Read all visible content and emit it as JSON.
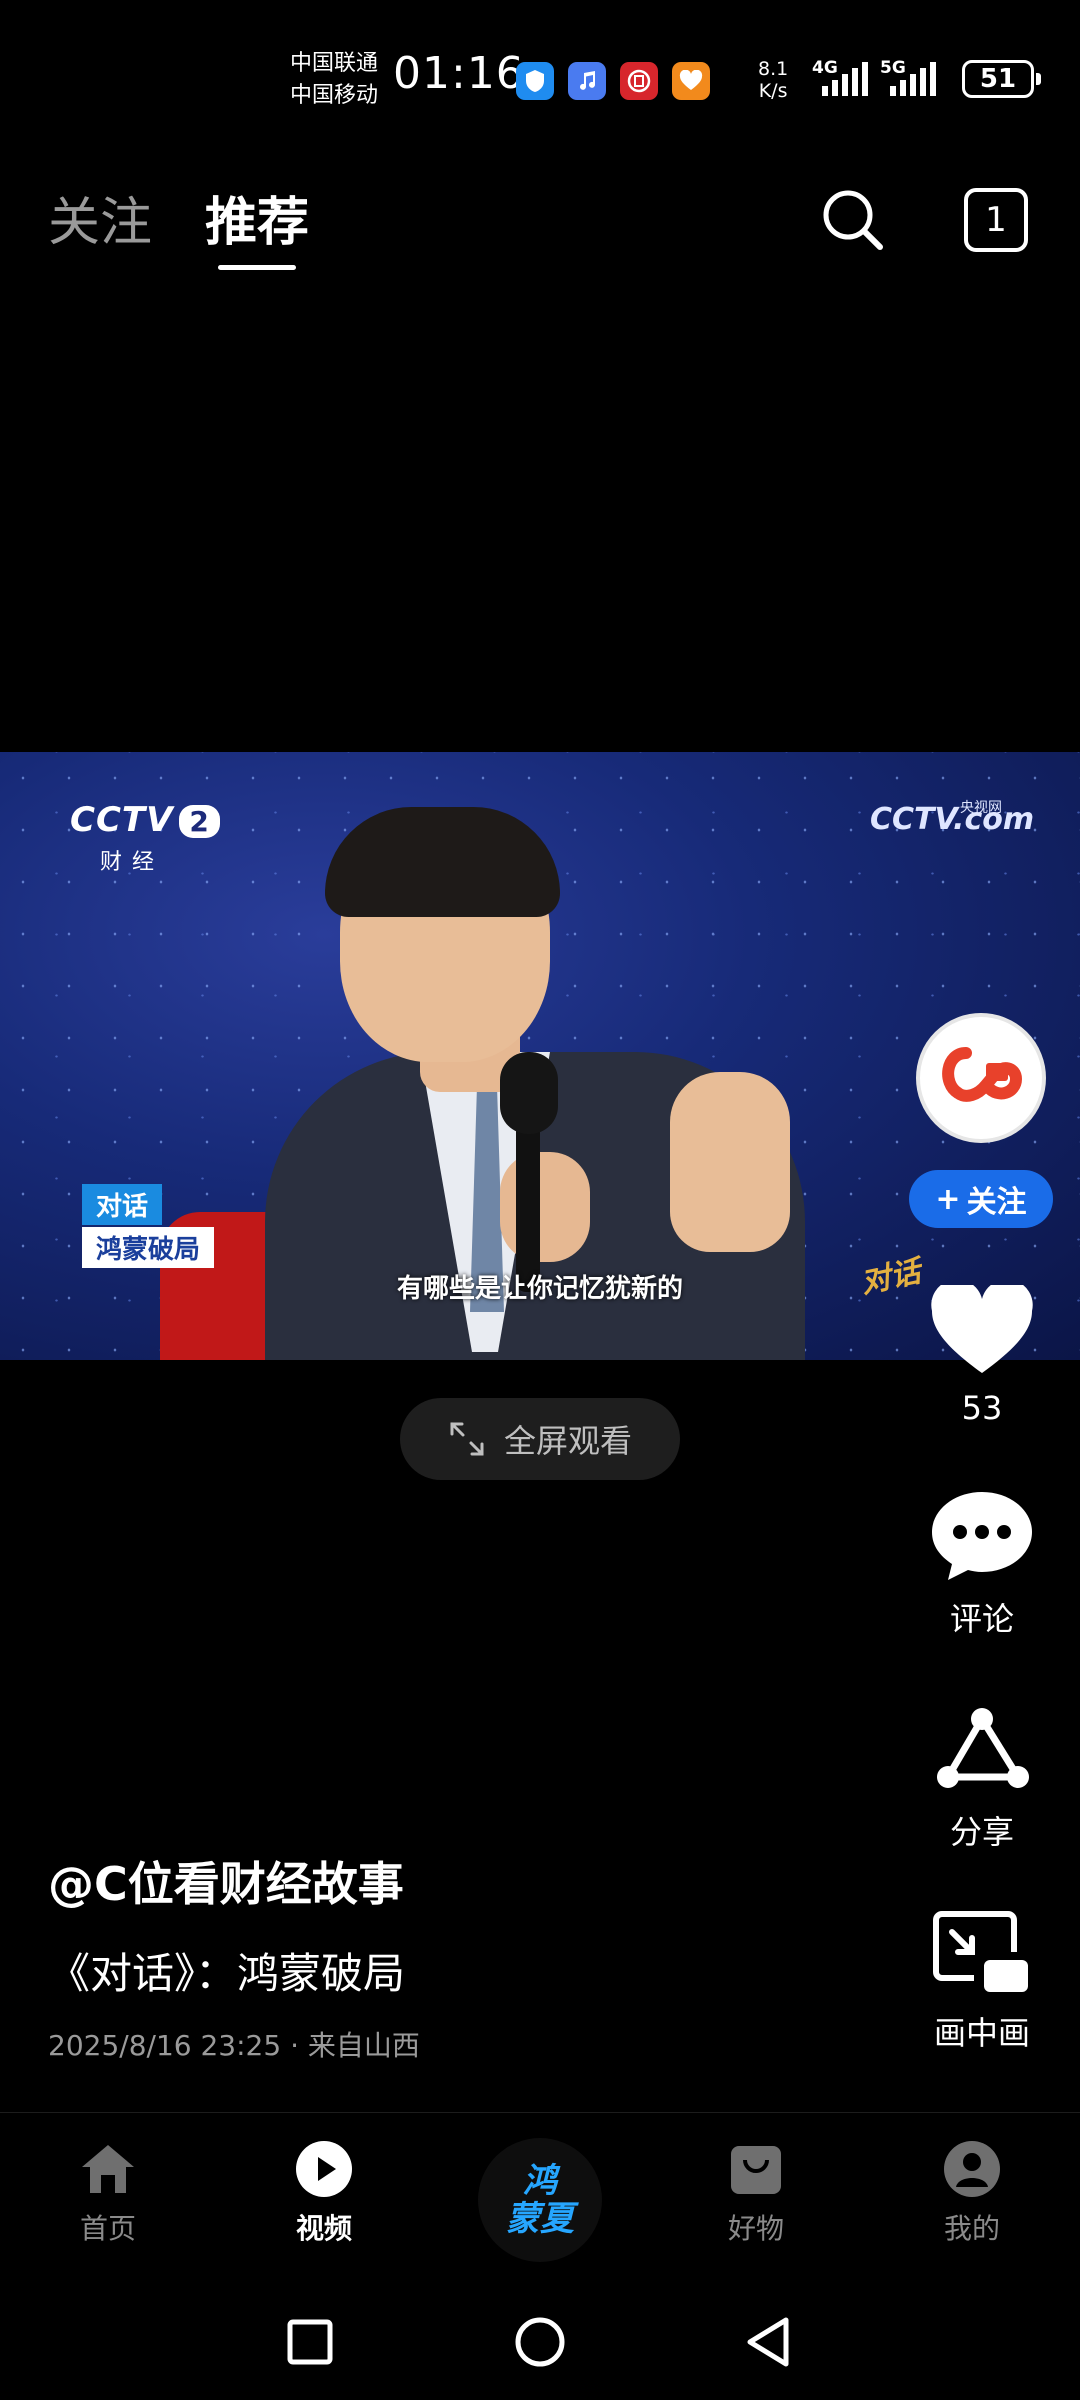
{
  "status_bar": {
    "carrier_1": "中国联通",
    "carrier_2": "中国移动",
    "time": "01:16",
    "net_speed_value": "8.1",
    "net_speed_unit": "K/s",
    "signal_1": "4G",
    "signal_2": "5G",
    "battery": "51"
  },
  "header": {
    "tab_follow": "关注",
    "tab_recommend": "推荐",
    "window_count": "1"
  },
  "video": {
    "channel_logo": "CCTV",
    "channel_num": "2",
    "channel_sub": "财经",
    "watermark": "CCTV.com",
    "watermark_sub": "央视网",
    "program_tag_1": "对话",
    "program_tag_2": "鸿蒙破局",
    "subtitle": "有哪些是让你记忆犹新的",
    "show_logo": "对话"
  },
  "fullscreen": {
    "label": "全屏观看"
  },
  "rail": {
    "follow_label": "关注",
    "like_count": "53",
    "comment_label": "评论",
    "share_label": "分享",
    "pip_label": "画中画"
  },
  "post": {
    "author": "@C位看财经故事",
    "title": "《对话》：鸿蒙破局",
    "date": "2025/8/16 23:25",
    "location": "来自山西"
  },
  "bottom_nav": {
    "home": "首页",
    "video": "视频",
    "center_logo_1": "鸿",
    "center_logo_2": "蒙夏",
    "goods": "好物",
    "mine": "我的"
  },
  "colors": {
    "accent_blue": "#1a6ce8",
    "background": "#000000",
    "inactive_text": "#9a9a9a"
  }
}
